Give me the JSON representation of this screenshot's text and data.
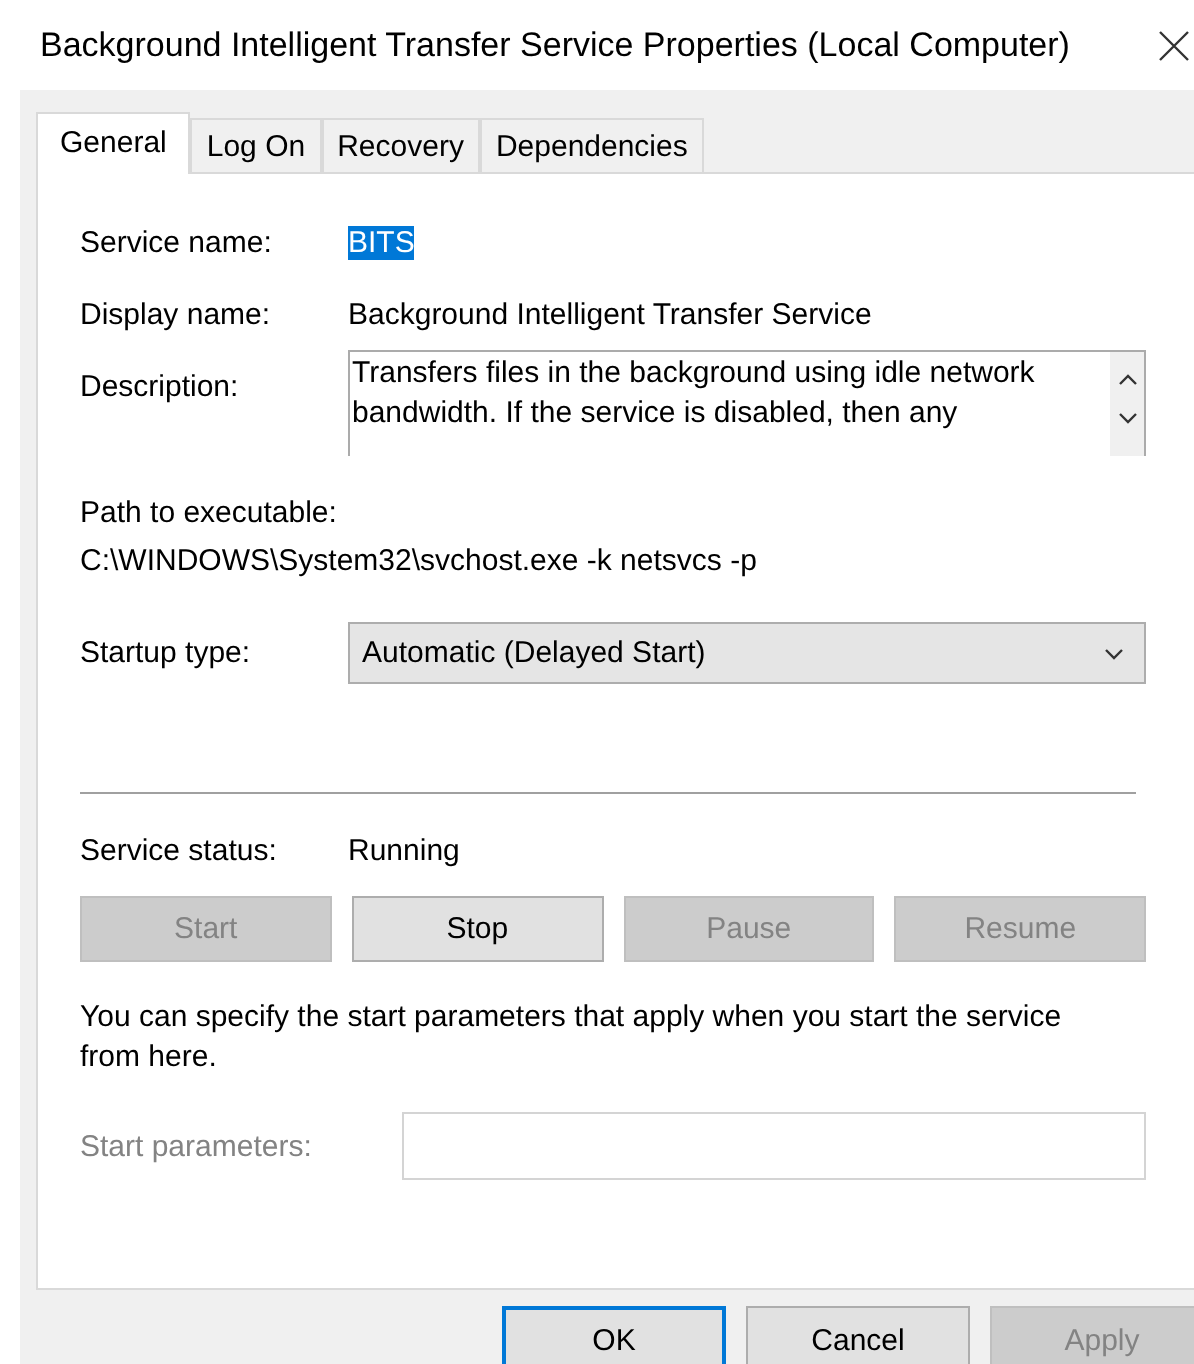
{
  "window": {
    "title": "Background Intelligent Transfer Service Properties (Local Computer)"
  },
  "tabs": [
    {
      "label": "General",
      "selected": true
    },
    {
      "label": "Log On",
      "selected": false
    },
    {
      "label": "Recovery",
      "selected": false
    },
    {
      "label": "Dependencies",
      "selected": false
    }
  ],
  "service_name": {
    "label": "Service name:",
    "value": "BITS",
    "selected": true
  },
  "display_name": {
    "label": "Display name:",
    "value": "Background Intelligent Transfer Service"
  },
  "description": {
    "label": "Description:",
    "value": "Transfers files in the background using idle network bandwidth. If the service is disabled, then any"
  },
  "path": {
    "label": "Path to executable:",
    "value": "C:\\WINDOWS\\System32\\svchost.exe -k netsvcs -p"
  },
  "startup_type": {
    "label": "Startup type:",
    "value": "Automatic (Delayed Start)"
  },
  "service_status": {
    "label": "Service status:",
    "value": "Running"
  },
  "service_buttons": [
    {
      "label": "Start",
      "disabled": true
    },
    {
      "label": "Stop",
      "disabled": false
    },
    {
      "label": "Pause",
      "disabled": true
    },
    {
      "label": "Resume",
      "disabled": true
    }
  ],
  "note": "You can specify the start parameters that apply when you start the service from here.",
  "start_parameters": {
    "label": "Start parameters:",
    "disabled": true
  },
  "dialog_buttons": [
    {
      "label": "OK",
      "disabled": false,
      "default": true
    },
    {
      "label": "Cancel",
      "disabled": false,
      "default": false
    },
    {
      "label": "Apply",
      "disabled": true,
      "default": false
    }
  ]
}
